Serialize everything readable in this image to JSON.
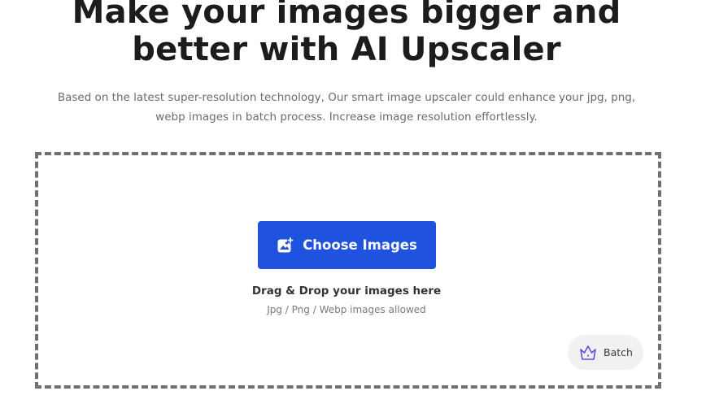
{
  "hero": {
    "title_line1": "Make your images bigger and",
    "title_line2": "better with AI Upscaler",
    "subtitle_line1": "Based on the latest super-resolution technology, Our smart image upscaler could enhance your jpg, png,",
    "subtitle_line2": "webp images in batch process. Increase image resolution effortlessly."
  },
  "upload": {
    "choose_label": "Choose Images",
    "choose_icon": "image-add-icon",
    "drag_text": "Drag & Drop your images here",
    "allowed_text": "Jpg / Png / Webp images allowed",
    "batch_label": "Batch",
    "batch_icon": "crown-icon"
  },
  "colors": {
    "primary_button": "#1f52de",
    "dashed_border": "#707070",
    "batch_bg": "#f1f1f1",
    "crown": "#5b4fd8"
  }
}
